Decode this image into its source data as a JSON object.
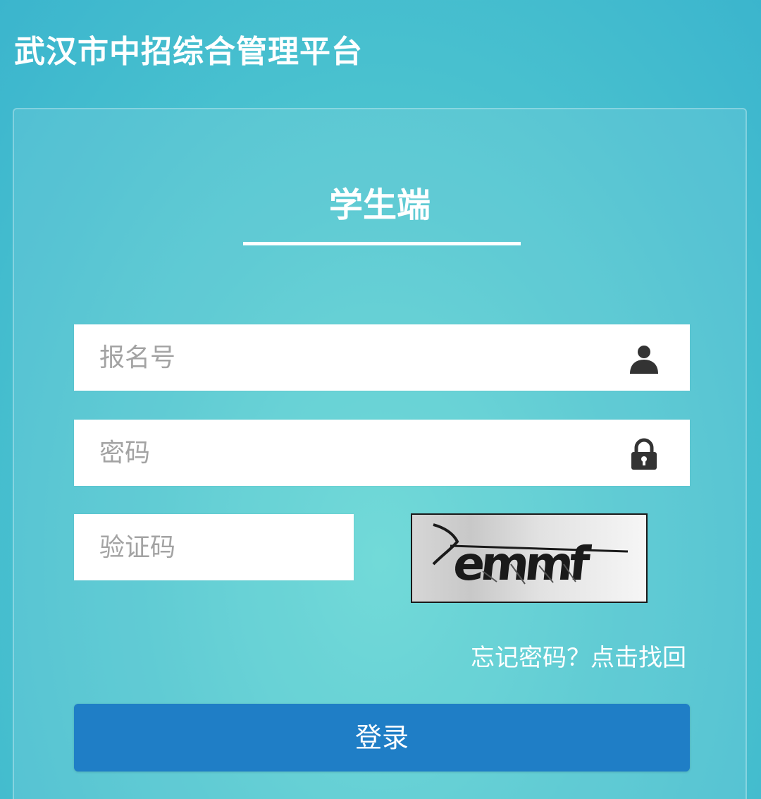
{
  "app": {
    "title": "武汉市中招综合管理平台"
  },
  "login": {
    "heading": "学生端",
    "username": {
      "placeholder": "报名号",
      "value": "",
      "icon": "user-icon"
    },
    "password": {
      "placeholder": "密码",
      "value": "",
      "icon": "lock-icon"
    },
    "captcha": {
      "placeholder": "验证码",
      "value": "",
      "image_text": "emmf"
    },
    "forgot_link": "忘记密码？点击找回",
    "submit_label": "登录"
  },
  "colors": {
    "background": "#4fc6d0",
    "button": "#1f7ec6",
    "icon": "#333333"
  }
}
